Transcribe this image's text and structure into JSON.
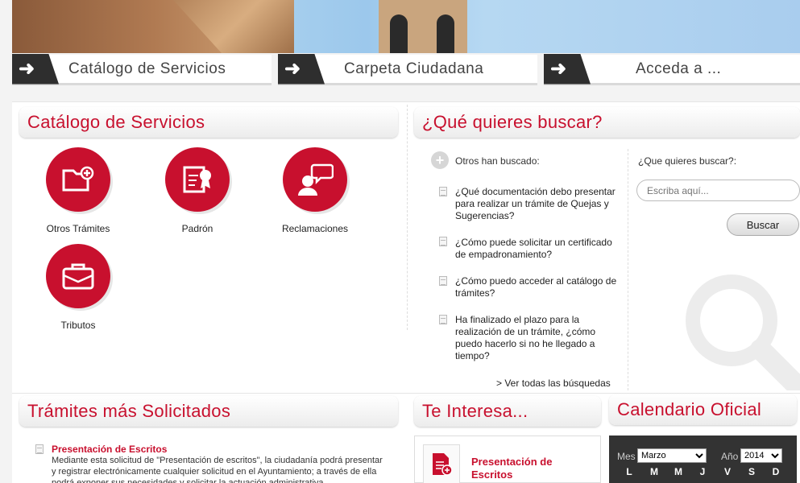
{
  "nav": {
    "tabs": [
      {
        "label": "Catálogo de Servicios",
        "arrow": "➜"
      },
      {
        "label": "Carpeta Ciudadana",
        "arrow": "➜"
      },
      {
        "label": "Acceda a ...",
        "arrow": "➜"
      }
    ]
  },
  "catalog": {
    "title": "Catálogo de Servicios",
    "items": [
      {
        "label": "Otros Trámites",
        "icon": "folder-plus-icon"
      },
      {
        "label": "Padrón",
        "icon": "certificate-icon"
      },
      {
        "label": "Reclamaciones",
        "icon": "speech-person-icon"
      },
      {
        "label": "Tributos",
        "icon": "briefcase-icon"
      }
    ]
  },
  "search": {
    "title": "¿Qué quieres buscar?",
    "others_label": "Otros han buscado:",
    "suggestions": [
      "¿Qué documentación debo presentar para realizar un trámite de Quejas y Sugerencias?",
      "¿Cómo puede solicitar un certificado de empadronamiento?",
      "¿Cómo puedo acceder al catálogo de trámites?",
      "Ha finalizado el plazo para la realización de un trámite, ¿cómo puedo hacerlo si no he llegado a tiempo?"
    ],
    "see_all": "> Ver todas las búsquedas",
    "field_label": "¿Que quieres buscar?:",
    "placeholder": "Escriba aquí...",
    "button": "Buscar"
  },
  "tramites": {
    "title": "Trámites más Solicitados",
    "item_title": "Presentación de Escritos",
    "item_desc": "Mediante esta solicitud de \"Presentación de escritos\", la ciudadanía podrá presentar y registrar electrónicamente cualquier solicitud en el Ayuntamiento; a través de ella podrá exponer sus necesidades y solicitar la actuación administrativa"
  },
  "interesa": {
    "title": "Te Interesa...",
    "item_label": "Presentación de Escritos"
  },
  "calendar": {
    "title": "Calendario Oficial",
    "month_label": "Mes",
    "month_value": "Marzo",
    "year_label": "Año",
    "year_value": "2014",
    "day_names": [
      "L",
      "M",
      "M",
      "J",
      "V",
      "S",
      "D"
    ]
  },
  "colors": {
    "accent": "#c8102e",
    "dark": "#2e2e2e"
  }
}
